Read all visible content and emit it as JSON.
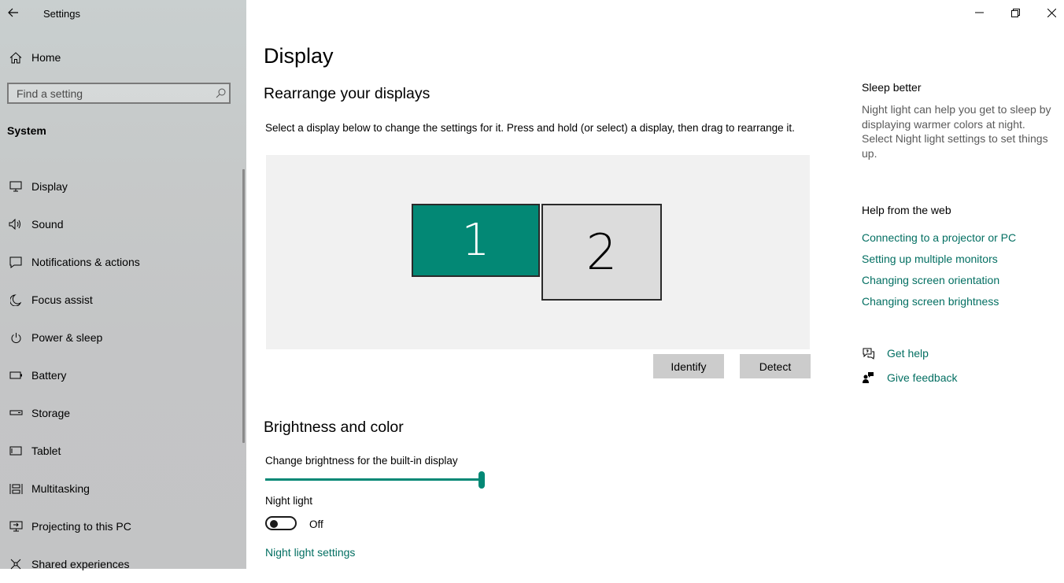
{
  "window": {
    "app_title": "Settings",
    "controls": [
      "minimize-icon",
      "restore-icon",
      "close-icon"
    ]
  },
  "sidebar": {
    "home_label": "Home",
    "search_placeholder": "Find a setting",
    "section_label": "System",
    "items": [
      {
        "label": "Display",
        "icon": "monitor-icon"
      },
      {
        "label": "Sound",
        "icon": "speaker-icon"
      },
      {
        "label": "Notifications & actions",
        "icon": "message-icon"
      },
      {
        "label": "Focus assist",
        "icon": "moon-icon"
      },
      {
        "label": "Power & sleep",
        "icon": "power-icon"
      },
      {
        "label": "Battery",
        "icon": "battery-icon"
      },
      {
        "label": "Storage",
        "icon": "storage-icon"
      },
      {
        "label": "Tablet",
        "icon": "tablet-icon"
      },
      {
        "label": "Multitasking",
        "icon": "multitasking-icon"
      },
      {
        "label": "Projecting to this PC",
        "icon": "projector-icon"
      },
      {
        "label": "Shared experiences",
        "icon": "share-icon"
      }
    ]
  },
  "main": {
    "title": "Display",
    "rearrange": {
      "heading": "Rearrange your displays",
      "description": "Select a display below to change the settings for it. Press and hold (or select) a display, then drag to rearrange it.",
      "monitors": [
        {
          "number": "1",
          "selected": true,
          "color": "#038875"
        },
        {
          "number": "2",
          "selected": false,
          "color": "#dcdcdc"
        }
      ],
      "identify_label": "Identify",
      "detect_label": "Detect"
    },
    "brightness": {
      "heading": "Brightness and color",
      "slider_label": "Change brightness for the built-in display",
      "slider_value_percent": 100,
      "night_light_label": "Night light",
      "night_light_state": "Off",
      "night_light_settings_link": "Night light settings"
    }
  },
  "right_panel": {
    "sleep_heading": "Sleep better",
    "sleep_text": "Night light can help you get to sleep by displaying warmer colors at night. Select Night light settings to set things up.",
    "help_heading": "Help from the web",
    "help_links": [
      "Connecting to a projector or PC",
      "Setting up multiple monitors",
      "Changing screen orientation",
      "Changing screen brightness"
    ],
    "get_help_label": "Get help",
    "give_feedback_label": "Give feedback"
  },
  "colors": {
    "accent": "#038875",
    "link": "#036f62",
    "sidebar_bg": "#c6c9c9"
  }
}
